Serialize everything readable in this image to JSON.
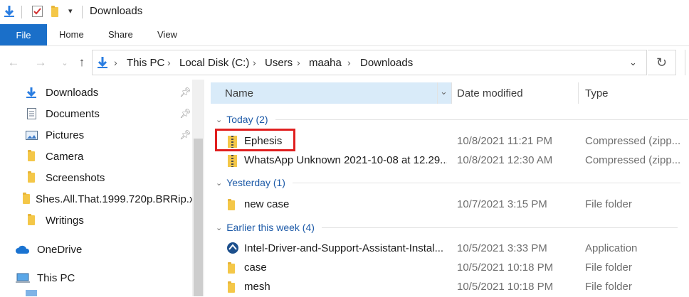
{
  "window": {
    "title": "Downloads"
  },
  "ribbon": {
    "tabs": [
      "File",
      "Home",
      "Share",
      "View"
    ]
  },
  "address": {
    "breadcrumbs": [
      "This PC",
      "Local Disk (C:)",
      "Users",
      "maaha",
      "Downloads"
    ]
  },
  "nav": {
    "items": [
      {
        "label": "Downloads",
        "icon": "download-arrow-icon",
        "pinned": true
      },
      {
        "label": "Documents",
        "icon": "document-icon",
        "pinned": true
      },
      {
        "label": "Pictures",
        "icon": "pictures-icon",
        "pinned": true
      },
      {
        "label": "Camera",
        "icon": "folder-icon"
      },
      {
        "label": "Screenshots",
        "icon": "folder-icon"
      },
      {
        "label": "Shes.All.That.1999.720p.BRRip.x",
        "icon": "folder-icon"
      },
      {
        "label": "Writings",
        "icon": "folder-icon"
      },
      {
        "label": "OneDrive",
        "icon": "cloud-icon"
      },
      {
        "label": "This PC",
        "icon": "computer-icon"
      }
    ]
  },
  "columns": {
    "name": "Name",
    "date": "Date modified",
    "type": "Type"
  },
  "groups": [
    {
      "label": "Today (2)",
      "files": [
        {
          "name": "Ephesis",
          "date": "10/8/2021 11:21 PM",
          "type": "Compressed (zipp...",
          "icon": "zip-icon"
        },
        {
          "name": "WhatsApp Unknown 2021-10-08 at 12.29...",
          "date": "10/8/2021 12:30 AM",
          "type": "Compressed (zipp...",
          "icon": "zip-icon"
        }
      ]
    },
    {
      "label": "Yesterday (1)",
      "files": [
        {
          "name": "new case",
          "date": "10/7/2021 3:15 PM",
          "type": "File folder",
          "icon": "folder-icon"
        }
      ]
    },
    {
      "label": "Earlier this week (4)",
      "files": [
        {
          "name": "Intel-Driver-and-Support-Assistant-Instal...",
          "date": "10/5/2021 3:33 PM",
          "type": "Application",
          "icon": "intel-installer-icon"
        },
        {
          "name": "case",
          "date": "10/5/2021 10:18 PM",
          "type": "File folder",
          "icon": "folder-icon"
        },
        {
          "name": "mesh",
          "date": "10/5/2021 10:18 PM",
          "type": "File folder",
          "icon": "folder-icon"
        }
      ]
    }
  ],
  "colors": {
    "accent": "#1a6fc9",
    "group_text": "#1e5ba8",
    "header_selected": "#d9ebf9",
    "highlight": "#e01f1f"
  }
}
